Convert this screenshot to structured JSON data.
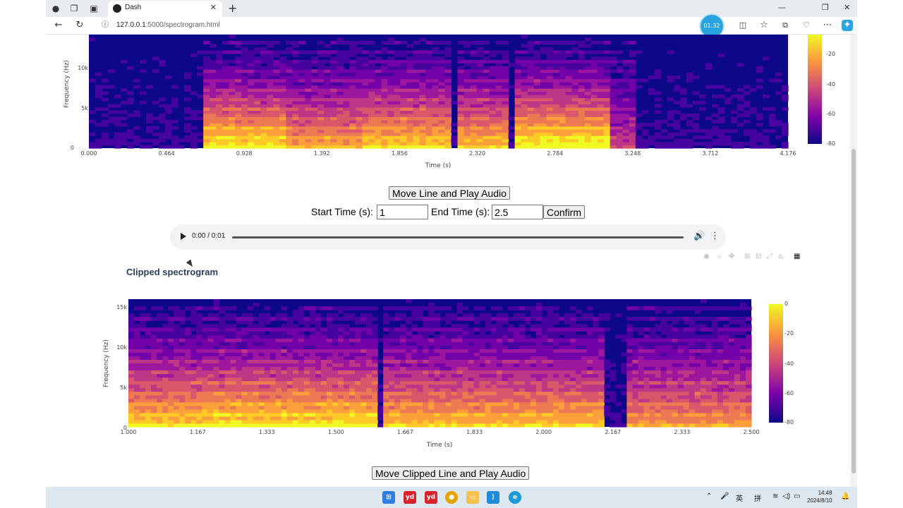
{
  "browser": {
    "tab_title": "Dash",
    "url_host": "127.0.0.1",
    "url_path": ":5000/spectrogram.html",
    "timer_badge": "01:32"
  },
  "controls": {
    "move_line_button": "Move Line and Play Audio",
    "start_time_label": "Start Time (s):",
    "start_time_value": "1",
    "end_time_label": "End Time (s):",
    "end_time_value": "2.5",
    "confirm_button": "Confirm",
    "move_clipped_button": "Move Clipped Line and Play Audio"
  },
  "audio": {
    "time": "0:00 / 0:01"
  },
  "clipped_title": "Clipped spectrogram",
  "chart_data": [
    {
      "type": "heatmap",
      "title": "",
      "xlabel": "Time (s)",
      "ylabel": "Frequency (Hz)",
      "xlim": [
        0,
        4.176
      ],
      "x_ticks": [
        "0.000",
        "0.464",
        "0.928",
        "1.392",
        "1.856",
        "2.320",
        "2.784",
        "3.248",
        "3.712",
        "4.176"
      ],
      "y_ticks_visible": [
        "0",
        "5k",
        "10k"
      ],
      "colorbar_ticks": [
        "-20",
        "-40",
        "-60",
        "-80"
      ],
      "colorscale": "plasma",
      "energy_regions": [
        {
          "start": 0.68,
          "end": 1.18,
          "level": 0.85
        },
        {
          "start": 1.18,
          "end": 1.62,
          "level": 0.7
        },
        {
          "start": 1.62,
          "end": 2.15,
          "level": 0.8
        },
        {
          "start": 2.22,
          "end": 2.52,
          "level": 0.75
        },
        {
          "start": 2.55,
          "end": 3.1,
          "level": 0.9
        },
        {
          "start": 3.1,
          "end": 3.25,
          "level": 0.4
        }
      ]
    },
    {
      "type": "heatmap",
      "title": "Clipped spectrogram",
      "xlabel": "Time (s)",
      "ylabel": "Frequency (Hz)",
      "xlim": [
        1.0,
        2.5
      ],
      "x_ticks": [
        "1.000",
        "1.167",
        "1.333",
        "1.500",
        "1.667",
        "1.833",
        "2.000",
        "2.167",
        "2.333",
        "2.500"
      ],
      "y_ticks": [
        "0",
        "5k",
        "10k",
        "15k"
      ],
      "colorbar_ticks": [
        "0",
        "-20",
        "-40",
        "-60",
        "-80"
      ],
      "colorscale": "plasma",
      "energy_regions": [
        {
          "start": 1.0,
          "end": 1.18,
          "level": 0.8
        },
        {
          "start": 1.18,
          "end": 1.6,
          "level": 0.85
        },
        {
          "start": 1.62,
          "end": 2.15,
          "level": 0.75
        },
        {
          "start": 2.2,
          "end": 2.5,
          "level": 0.65
        }
      ]
    }
  ],
  "taskbar": {
    "ime_1": "英",
    "ime_2": "拼",
    "time": "14:48",
    "date": "2024/8/10"
  }
}
